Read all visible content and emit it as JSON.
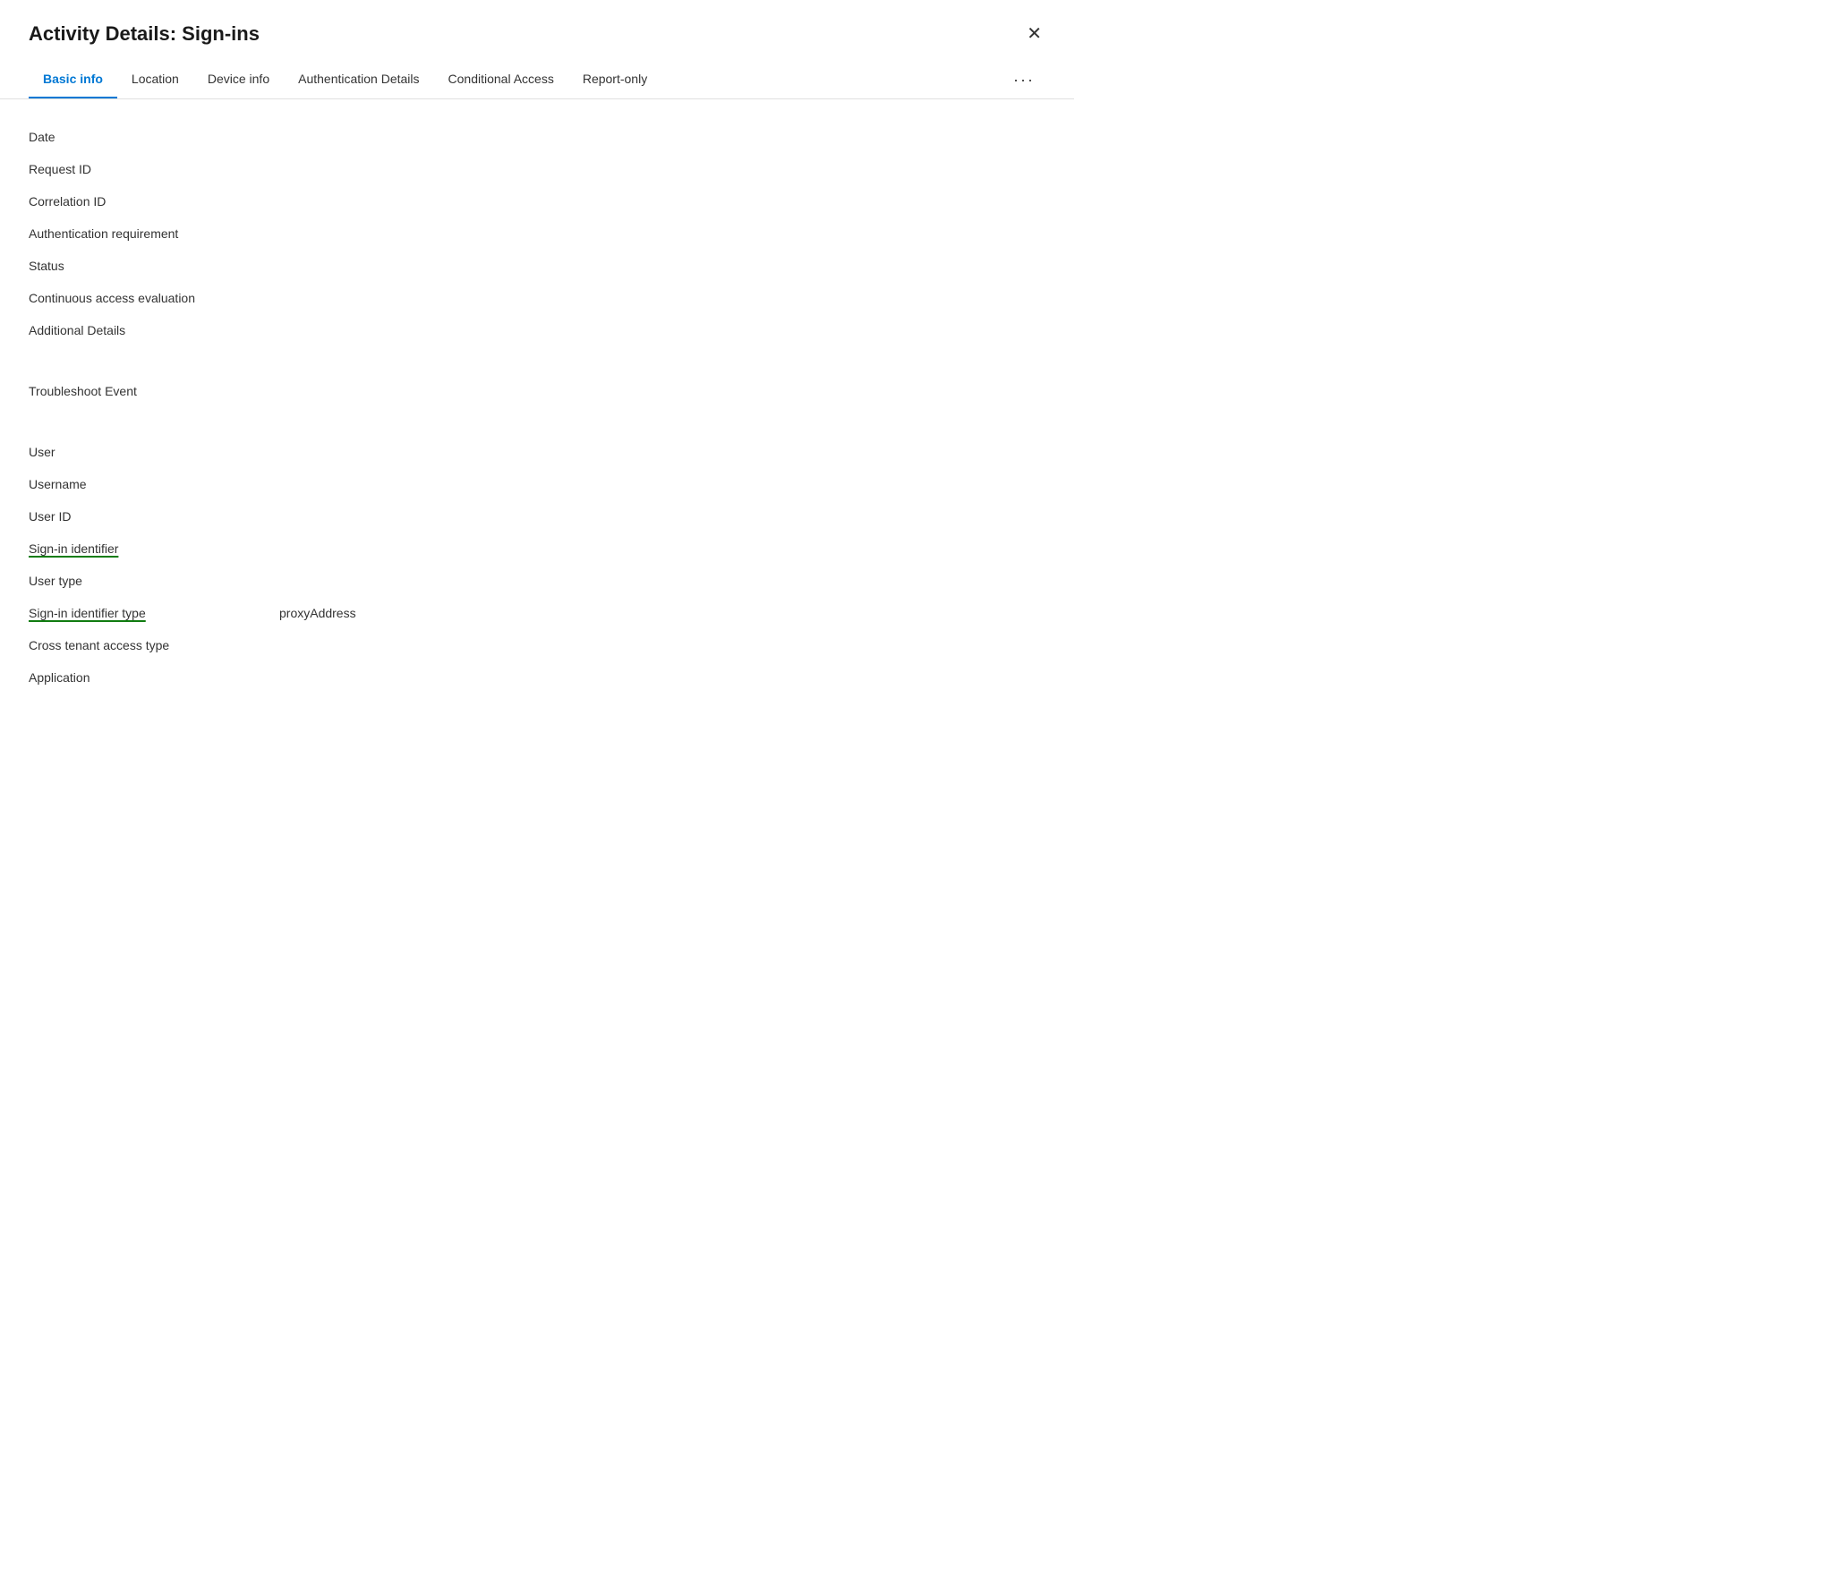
{
  "dialog": {
    "title": "Activity Details: Sign-ins",
    "close_label": "✕"
  },
  "tabs": [
    {
      "id": "basic-info",
      "label": "Basic info",
      "active": true
    },
    {
      "id": "location",
      "label": "Location",
      "active": false
    },
    {
      "id": "device-info",
      "label": "Device info",
      "active": false
    },
    {
      "id": "authentication-details",
      "label": "Authentication Details",
      "active": false
    },
    {
      "id": "conditional-access",
      "label": "Conditional Access",
      "active": false
    },
    {
      "id": "report-only",
      "label": "Report-only",
      "active": false
    }
  ],
  "tabs_more_label": "···",
  "fields": {
    "section1": [
      {
        "id": "date",
        "label": "Date",
        "value": "",
        "underlined": false
      },
      {
        "id": "request-id",
        "label": "Request ID",
        "value": "",
        "underlined": false
      },
      {
        "id": "correlation-id",
        "label": "Correlation ID",
        "value": "",
        "underlined": false
      },
      {
        "id": "auth-requirement",
        "label": "Authentication requirement",
        "value": "",
        "underlined": false
      },
      {
        "id": "status",
        "label": "Status",
        "value": "",
        "underlined": false
      },
      {
        "id": "continuous-access",
        "label": "Continuous access evaluation",
        "value": "",
        "underlined": false
      },
      {
        "id": "additional-details",
        "label": "Additional Details",
        "value": "",
        "underlined": false
      }
    ],
    "section2": [
      {
        "id": "troubleshoot-event",
        "label": "Troubleshoot Event",
        "value": "",
        "underlined": false
      }
    ],
    "section3": [
      {
        "id": "user",
        "label": "User",
        "value": "",
        "underlined": false
      },
      {
        "id": "username",
        "label": "Username",
        "value": "",
        "underlined": false
      },
      {
        "id": "user-id",
        "label": "User ID",
        "value": "",
        "underlined": false
      },
      {
        "id": "sign-in-identifier",
        "label": "Sign-in identifier",
        "value": "",
        "underlined": true
      },
      {
        "id": "user-type",
        "label": "User type",
        "value": "",
        "underlined": false
      },
      {
        "id": "sign-in-identifier-type",
        "label": "Sign-in identifier type",
        "value": "proxyAddress",
        "underlined": true
      },
      {
        "id": "cross-tenant-access-type",
        "label": "Cross tenant access type",
        "value": "",
        "underlined": false
      },
      {
        "id": "application",
        "label": "Application",
        "value": "",
        "underlined": false
      }
    ]
  }
}
